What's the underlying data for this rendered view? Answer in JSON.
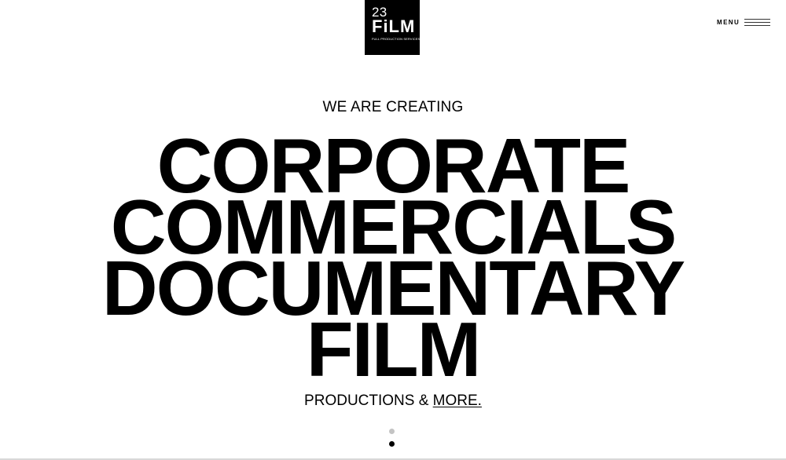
{
  "logo": {
    "number": "23",
    "word": "FiLM",
    "tagline": "FULL PRODUCTION SERVICES"
  },
  "menu": {
    "label": "MENU"
  },
  "hero": {
    "eyebrow": "WE ARE CREATING",
    "lines": [
      "CORPORATE",
      "COMMERCIALS",
      "DOCUMENTARY",
      "FILM"
    ],
    "tagline_prefix": "PRODUCTIONS & ",
    "tagline_link": "MORE."
  },
  "pager": {
    "count": 2,
    "active_index": 1
  },
  "colors": {
    "background": "#ffffff",
    "text": "#000000",
    "logo_bg": "#000000",
    "dot_inactive": "#c4c4c4",
    "dot_active": "#000000"
  }
}
